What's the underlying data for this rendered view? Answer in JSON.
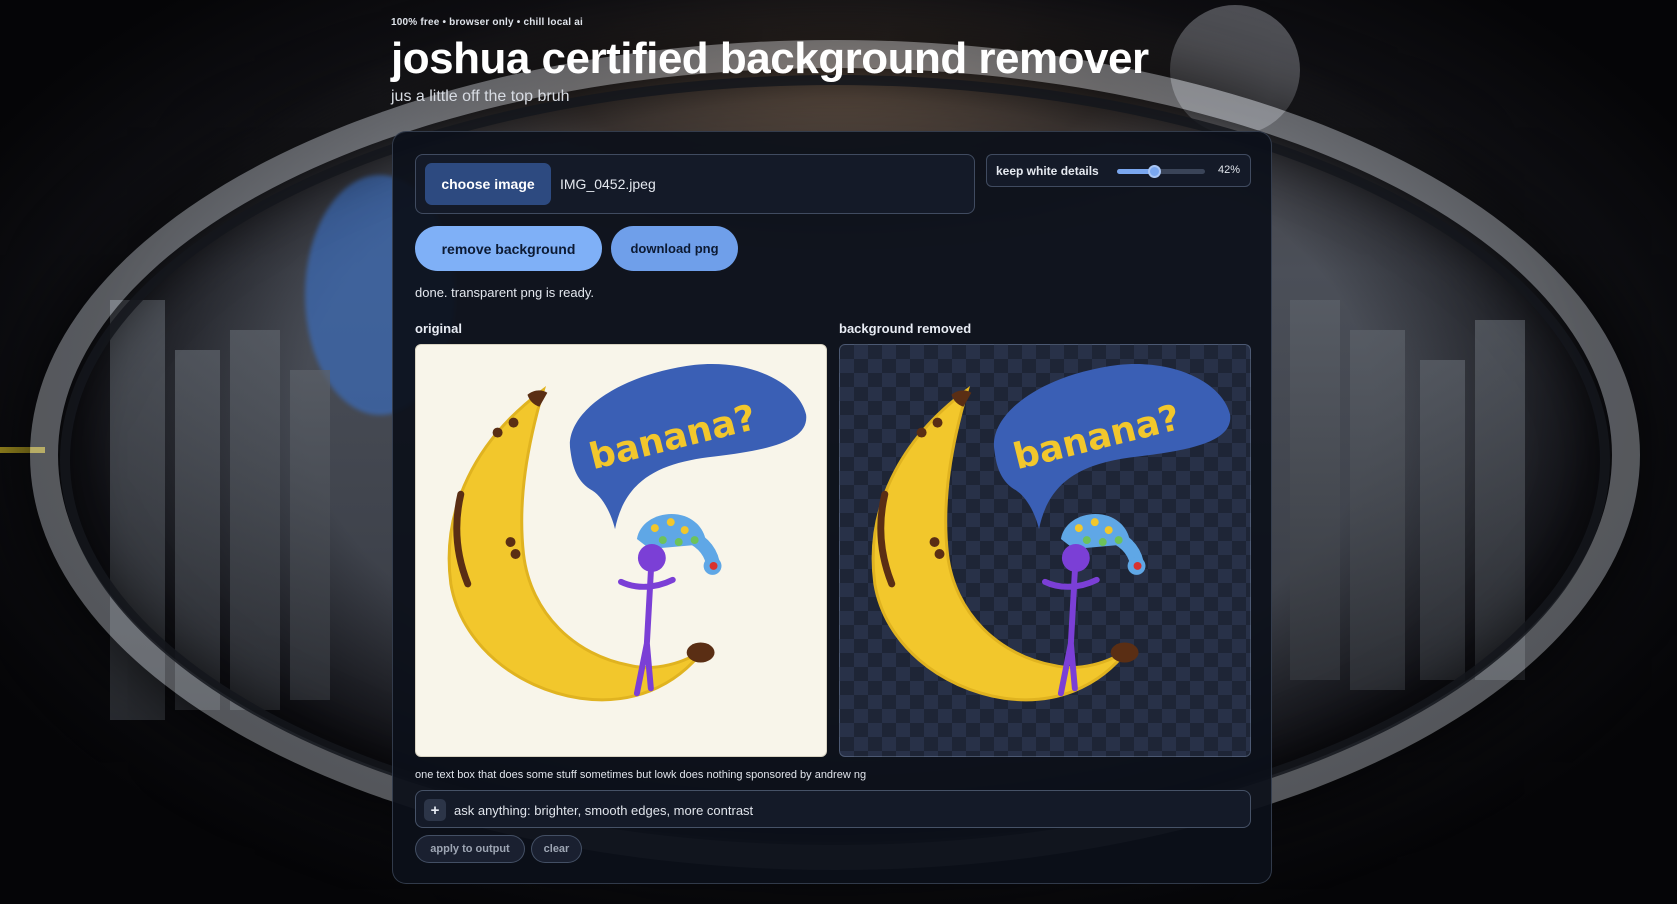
{
  "header": {
    "eyebrow": "100% free • browser only • chill local ai",
    "title": "joshua certified background remover",
    "subtitle": "jus a little off the top bruh"
  },
  "upload": {
    "choose_label": "choose image",
    "file_name": "IMG_0452.jpeg"
  },
  "slider": {
    "label": "keep white details",
    "value_percent": 42,
    "value_text": "42%"
  },
  "actions": {
    "remove_label": "remove background",
    "download_label": "download png"
  },
  "status": "done. transparent png is ready.",
  "preview": {
    "original_label": "original",
    "output_label": "background removed",
    "bubble_text": "banana?"
  },
  "prompt": {
    "caption": "one text box that does some stuff sometimes but lowk does nothing sponsored by andrew ng",
    "plus_label": "+",
    "placeholder": "ask anything: brighter, smooth edges, more contrast",
    "apply_label": "apply to output",
    "clear_label": "clear"
  },
  "colors": {
    "accent": "#7fb0f7",
    "panel": "#0c101a",
    "banana": "#f2c72c",
    "bubble": "#3a5fb5",
    "figure": "#7b3fd6"
  }
}
